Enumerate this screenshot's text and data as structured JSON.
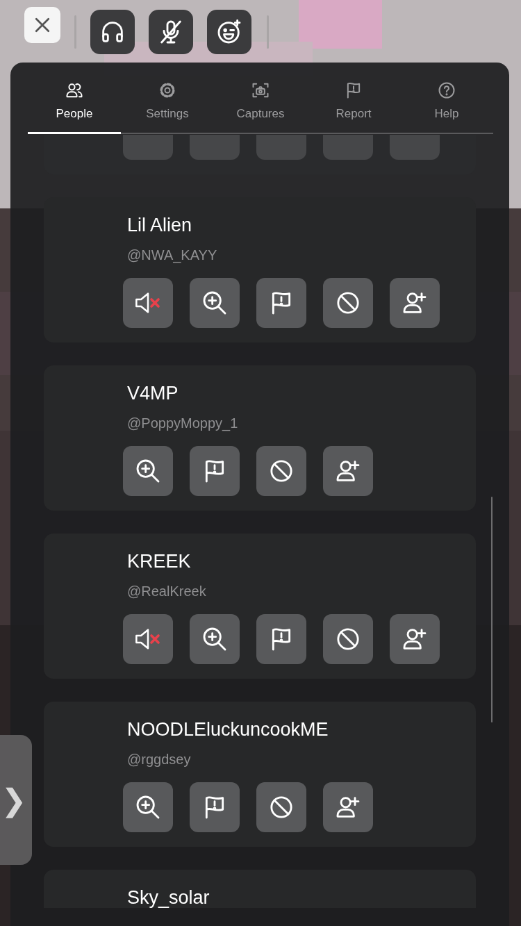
{
  "top_bar": {
    "buttons": [
      {
        "kind": "close"
      },
      {
        "kind": "headphones"
      },
      {
        "kind": "mic_off"
      },
      {
        "kind": "emoji"
      }
    ]
  },
  "tabs": [
    {
      "kind": "people",
      "label": "People",
      "selected": true
    },
    {
      "kind": "settings",
      "label": "Settings",
      "selected": false
    },
    {
      "kind": "captures",
      "label": "Captures",
      "selected": false
    },
    {
      "kind": "report",
      "label": "Report",
      "selected": false
    },
    {
      "kind": "help",
      "label": "Help",
      "selected": false
    }
  ],
  "players": [
    {
      "kind": "partial",
      "buttons": [
        {
          "kind": "blank"
        },
        {
          "kind": "blank"
        },
        {
          "kind": "blank"
        },
        {
          "kind": "blank"
        },
        {
          "kind": "blank"
        }
      ]
    },
    {
      "kind": "full",
      "name": "Lil Alien",
      "handle": "@NWA_KAYY",
      "buttons": [
        {
          "kind": "mute",
          "muted": true
        },
        {
          "kind": "inspect"
        },
        {
          "kind": "report"
        },
        {
          "kind": "block"
        },
        {
          "kind": "add_friend"
        }
      ]
    },
    {
      "kind": "full",
      "name": "V4MP",
      "handle": "@PoppyMoppy_1",
      "buttons": [
        {
          "kind": "inspect"
        },
        {
          "kind": "report"
        },
        {
          "kind": "block"
        },
        {
          "kind": "add_friend"
        }
      ]
    },
    {
      "kind": "full",
      "name": "KREEK",
      "handle": "@RealKreek",
      "buttons": [
        {
          "kind": "mute",
          "muted": true
        },
        {
          "kind": "inspect"
        },
        {
          "kind": "report"
        },
        {
          "kind": "block"
        },
        {
          "kind": "add_friend"
        }
      ]
    },
    {
      "kind": "full",
      "name": "NOODLEluckuncookME",
      "handle": "@rggdsey",
      "buttons": [
        {
          "kind": "inspect"
        },
        {
          "kind": "report"
        },
        {
          "kind": "block"
        },
        {
          "kind": "add_friend"
        }
      ]
    },
    {
      "kind": "cut",
      "name": "Sky_solar"
    }
  ],
  "side_tab": {
    "glyph": "❯"
  }
}
